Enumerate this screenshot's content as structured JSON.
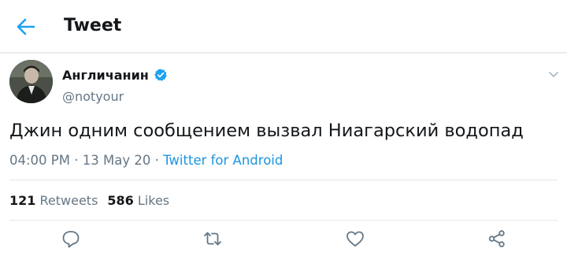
{
  "header": {
    "title": "Tweet",
    "back_icon": "arrow-left-icon"
  },
  "author": {
    "name": "Англичанин",
    "handle": "@notyour",
    "verified": true,
    "verified_icon": "verified-badge-icon"
  },
  "tweet": {
    "text": "Джин одним сообщением вызвал Ниагарский водопад",
    "time": "04:00 PM",
    "date": "13 May 20",
    "separator": "·",
    "source": "Twitter for Android"
  },
  "stats": {
    "retweets_count": "121",
    "retweets_label": "Retweets",
    "likes_count": "586",
    "likes_label": "Likes"
  },
  "actions": [
    {
      "name": "reply",
      "icon": "reply-icon"
    },
    {
      "name": "retweet",
      "icon": "retweet-icon"
    },
    {
      "name": "like",
      "icon": "heart-icon"
    },
    {
      "name": "share",
      "icon": "share-icon"
    }
  ],
  "colors": {
    "accent": "#1da1f2",
    "link": "#1b95e0",
    "secondary_text": "#657786",
    "primary_text": "#14171a",
    "divider": "#e1e8ed"
  }
}
